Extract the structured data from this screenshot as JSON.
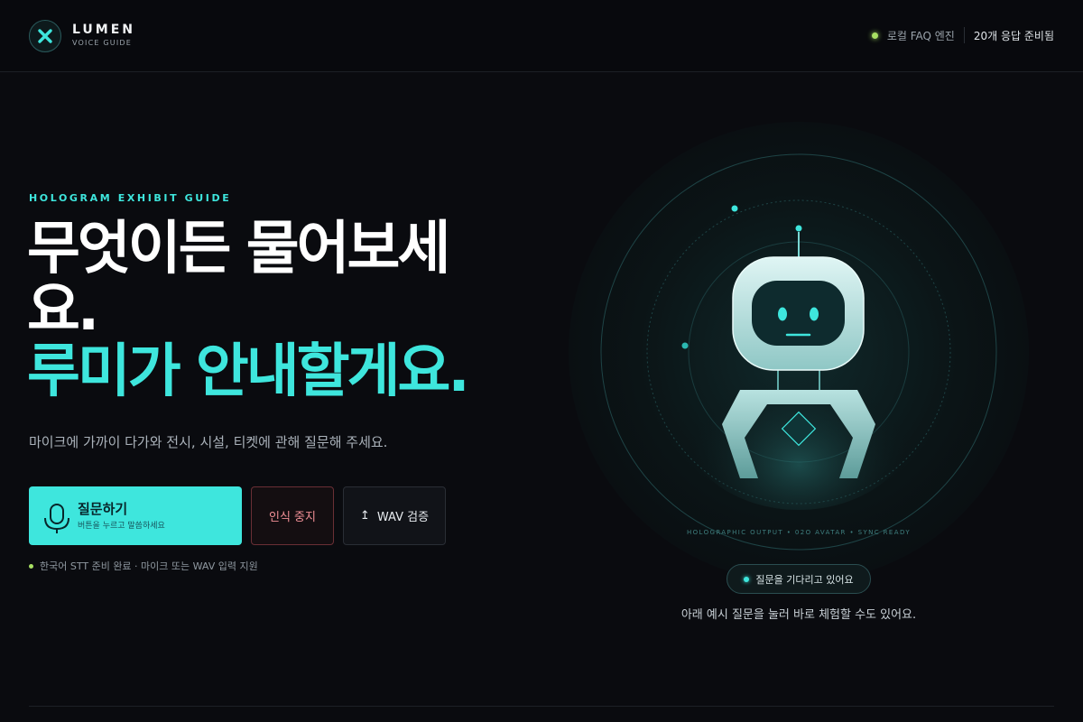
{
  "brand": {
    "name": "LUMEN",
    "tagline": "VOICE GUIDE",
    "logo_icon": "close-x-icon",
    "accent_color": "#3ee6dd"
  },
  "header_status": {
    "engine_label": "로컬 FAQ 엔진",
    "responses_label": "20개 응답 준비됨",
    "status_color": "#a8e063"
  },
  "hero": {
    "eyebrow": "HOLOGRAM EXHIBIT GUIDE",
    "headline_line1": "무엇이든 물어보세요.",
    "headline_line2": "루미가 안내할게요.",
    "subtitle": "마이크에 가까이 다가와 전시, 시설, 티켓에 관해 질문해 주세요."
  },
  "actions": {
    "ask_title": "질문하기",
    "ask_subtitle": "버튼을 누르고 말씀하세요",
    "ask_icon": "microphone-icon",
    "stop_label": "인식 중지",
    "wav_icon": "upload-arrow-icon",
    "wav_label": "WAV 검증",
    "wav_arrow": "↥"
  },
  "ready_status": "한국어 STT 준비 완료 · 마이크 또는 WAV 입력 지원",
  "avatar": {
    "caption": "HOLOGRAPHIC OUTPUT • 02O AVATAR • SYNC READY",
    "state_label": "질문을 기다리고 있어요",
    "hint": "아래 예시 질문을 눌러 바로 체험할 수도 있어요."
  }
}
